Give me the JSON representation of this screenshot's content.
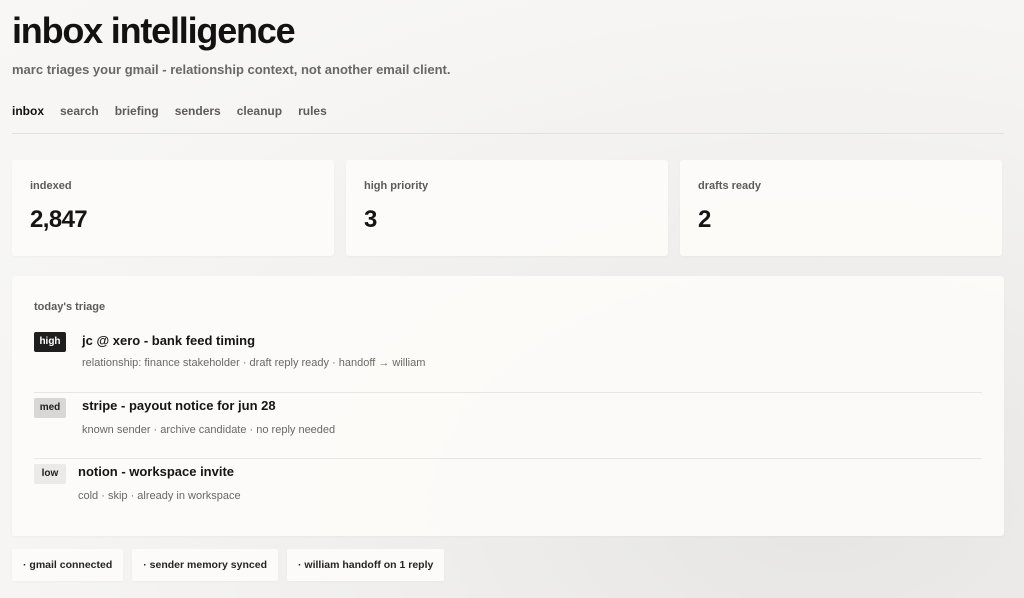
{
  "header": {
    "title": "inbox intelligence",
    "subtitle": "marc triages your gmail - relationship context, not another email client."
  },
  "nav": {
    "items": [
      {
        "label": "inbox",
        "active": true
      },
      {
        "label": "search",
        "active": false
      },
      {
        "label": "briefing",
        "active": false
      },
      {
        "label": "senders",
        "active": false
      },
      {
        "label": "cleanup",
        "active": false
      },
      {
        "label": "rules",
        "active": false
      }
    ]
  },
  "stats": [
    {
      "label": "indexed",
      "value": "2,847"
    },
    {
      "label": "high priority",
      "value": "3"
    },
    {
      "label": "drafts ready",
      "value": "2"
    }
  ],
  "triage": {
    "title": "today's triage",
    "items": [
      {
        "priority": "high",
        "subject": "jc @ xero - bank feed timing",
        "meta": "relationship: finance stakeholder · draft reply ready · handoff → william"
      },
      {
        "priority": "med",
        "subject": "stripe - payout notice for jun 28",
        "meta": "known sender · archive candidate · no reply needed"
      },
      {
        "priority": "low",
        "subject": "notion - workspace invite",
        "meta": "cold · skip · already in workspace"
      }
    ]
  },
  "status_pills": [
    {
      "label": "· gmail connected"
    },
    {
      "label": "· sender memory synced"
    },
    {
      "label": "· william handoff on 1 reply"
    }
  ],
  "colors": {
    "high_badge": "#1e1e1e",
    "med_badge": "#d8d7d5",
    "low_badge": "#ebeae8"
  }
}
